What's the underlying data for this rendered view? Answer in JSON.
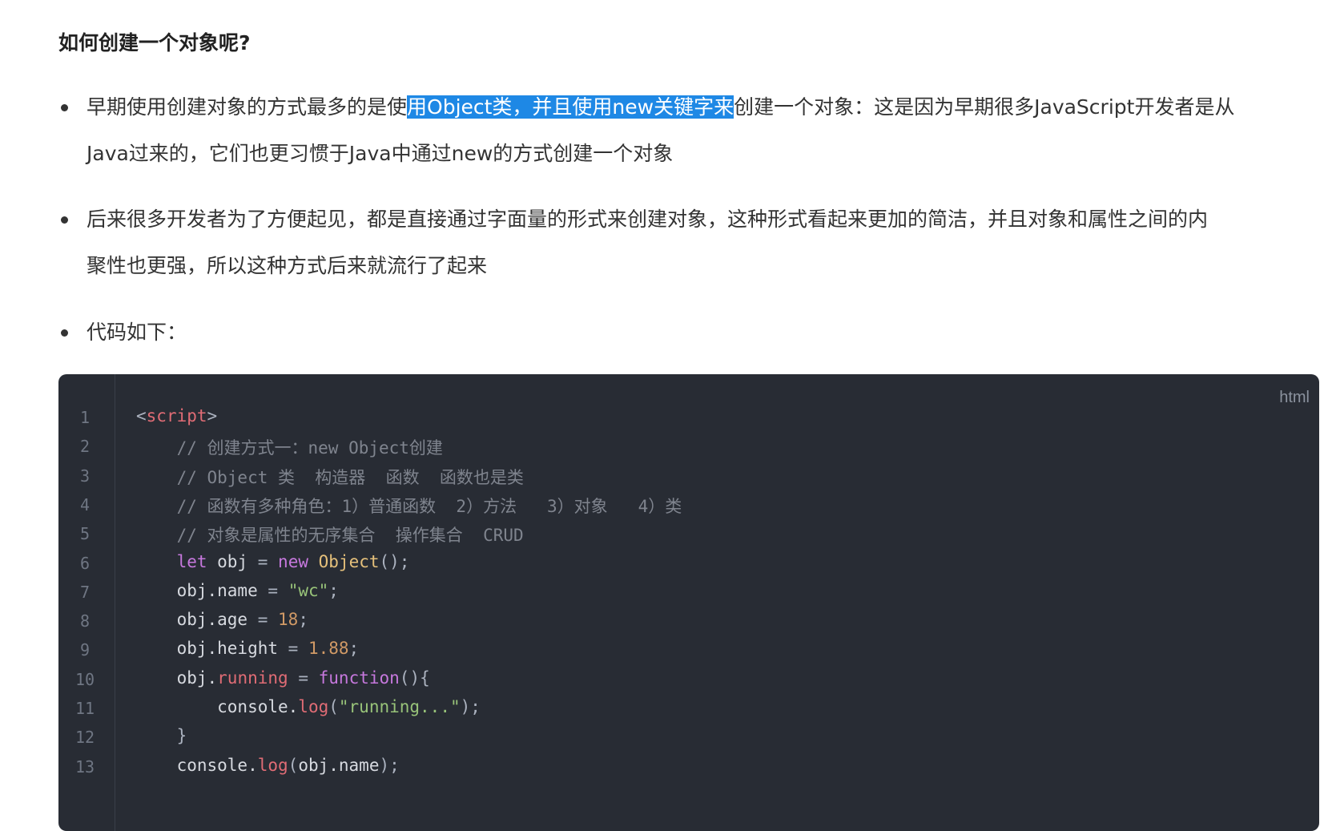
{
  "heading": "如何创建一个对象呢?",
  "bullets": [
    {
      "lines": [
        {
          "before": "早期使用创建对象的方式最多的是使",
          "highlight": "用Object类，并且使用new关键字来",
          "after": "创建一个对象：这是因为早期很多JavaScript开发者是从"
        },
        {
          "before": "Java过来的，它们也更习惯于Java中通过new的方式创建一个对象",
          "highlight": "",
          "after": ""
        }
      ]
    },
    {
      "lines": [
        {
          "before": "后来很多开发者为了方便起见，都是直接通过字面量的形式来创建对象，这种形式看起来更加的简洁，并且对象和属性之间的内",
          "highlight": "",
          "after": ""
        },
        {
          "before": "聚性也更强，所以这种方式后来就流行了起来",
          "highlight": "",
          "after": ""
        }
      ]
    },
    {
      "lines": [
        {
          "before": "代码如下：",
          "highlight": "",
          "after": ""
        }
      ]
    }
  ],
  "code": {
    "language": "html",
    "lines": [
      {
        "no": "1",
        "tokens": [
          [
            "punc",
            "<"
          ],
          [
            "tag",
            "script"
          ],
          [
            "punc",
            ">"
          ]
        ]
      },
      {
        "no": "2",
        "tokens": [
          [
            "plain",
            "    "
          ],
          [
            "comment",
            "// 创建方式一：new Object创建"
          ]
        ]
      },
      {
        "no": "3",
        "tokens": [
          [
            "plain",
            "    "
          ],
          [
            "comment",
            "// Object 类  构造器  函数  函数也是类"
          ]
        ]
      },
      {
        "no": "4",
        "tokens": [
          [
            "plain",
            "    "
          ],
          [
            "comment",
            "// 函数有多种角色：1）普通函数  2）方法   3）对象   4）类"
          ]
        ]
      },
      {
        "no": "5",
        "tokens": [
          [
            "plain",
            "    "
          ],
          [
            "comment",
            "// 对象是属性的无序集合  操作集合  CRUD"
          ]
        ]
      },
      {
        "no": "6",
        "tokens": [
          [
            "plain",
            "    "
          ],
          [
            "kw",
            "let"
          ],
          [
            "plain",
            " obj "
          ],
          [
            "punc",
            "="
          ],
          [
            "plain",
            " "
          ],
          [
            "kw",
            "new"
          ],
          [
            "plain",
            " "
          ],
          [
            "cls",
            "Object"
          ],
          [
            "punc",
            "();"
          ]
        ]
      },
      {
        "no": "7",
        "tokens": [
          [
            "plain",
            "    obj.name "
          ],
          [
            "punc",
            "="
          ],
          [
            "plain",
            " "
          ],
          [
            "str",
            "\"wc\""
          ],
          [
            "punc",
            ";"
          ]
        ]
      },
      {
        "no": "8",
        "tokens": [
          [
            "plain",
            "    obj.age "
          ],
          [
            "punc",
            "="
          ],
          [
            "plain",
            " "
          ],
          [
            "num",
            "18"
          ],
          [
            "punc",
            ";"
          ]
        ]
      },
      {
        "no": "9",
        "tokens": [
          [
            "plain",
            "    obj.height "
          ],
          [
            "punc",
            "="
          ],
          [
            "plain",
            " "
          ],
          [
            "num",
            "1.88"
          ],
          [
            "punc",
            ";"
          ]
        ]
      },
      {
        "no": "10",
        "tokens": [
          [
            "plain",
            "    obj."
          ],
          [
            "fn",
            "running"
          ],
          [
            "plain",
            " "
          ],
          [
            "punc",
            "="
          ],
          [
            "plain",
            " "
          ],
          [
            "func",
            "function"
          ],
          [
            "punc",
            "(){"
          ]
        ]
      },
      {
        "no": "11",
        "tokens": [
          [
            "plain",
            "        console."
          ],
          [
            "fn",
            "log"
          ],
          [
            "punc",
            "("
          ],
          [
            "str",
            "\"running...\""
          ],
          [
            "punc",
            ");"
          ]
        ]
      },
      {
        "no": "12",
        "tokens": [
          [
            "plain",
            "    "
          ],
          [
            "punc",
            "}"
          ]
        ]
      },
      {
        "no": "13",
        "tokens": [
          [
            "plain",
            "    console."
          ],
          [
            "fn",
            "log"
          ],
          [
            "punc",
            "("
          ],
          [
            "plain",
            "obj.name"
          ],
          [
            "punc",
            ");"
          ]
        ]
      }
    ]
  }
}
